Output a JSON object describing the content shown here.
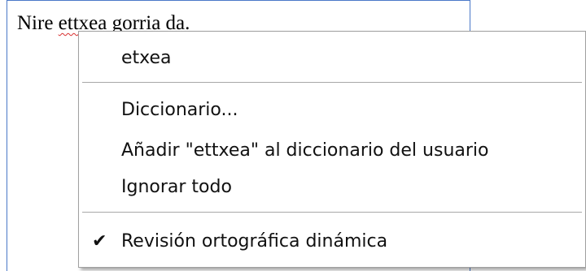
{
  "document": {
    "text_before": "Nire ",
    "misspelled_word": "ettxea",
    "text_after": " gorria da."
  },
  "context_menu": {
    "suggestion": "etxea",
    "dictionary": "Diccionario...",
    "add_to_dictionary": "Añadir \"ettxea\" al diccionario del usuario",
    "ignore_all": "Ignorar todo",
    "dynamic_spellcheck": "Revisión ortográfica dinámica",
    "dynamic_spellcheck_checked": true,
    "check_glyph": "✔"
  }
}
